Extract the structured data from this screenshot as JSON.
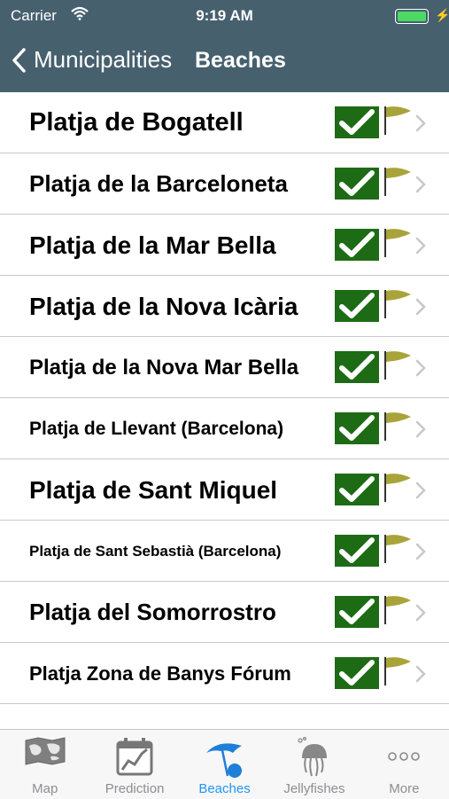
{
  "status": {
    "carrier": "Carrier",
    "time": "9:19 AM",
    "battery_level": 1.0
  },
  "nav": {
    "back_label": "Municipalities",
    "title": "Beaches"
  },
  "beaches": [
    {
      "name": "Platja de Bogatell",
      "size": "29px"
    },
    {
      "name": "Platja de la Barceloneta",
      "size": "26px"
    },
    {
      "name": "Platja de la Mar Bella",
      "size": "28px"
    },
    {
      "name": "Platja de la Nova Icària",
      "size": "28px"
    },
    {
      "name": "Platja de la Nova Mar Bella",
      "size": "24px"
    },
    {
      "name": "Platja de Llevant (Barcelona)",
      "size": "21px"
    },
    {
      "name": "Platja de Sant Miquel",
      "size": "28px"
    },
    {
      "name": "Platja de Sant Sebastià (Barcelona)",
      "size": "17px"
    },
    {
      "name": "Platja del Somorrostro",
      "size": "26px"
    },
    {
      "name": "Platja Zona de Banys Fórum",
      "size": "22px"
    }
  ],
  "tabs": [
    {
      "label": "Map",
      "icon": "map-icon",
      "active": false
    },
    {
      "label": "Prediction",
      "icon": "prediction-chart-icon",
      "active": false
    },
    {
      "label": "Beaches",
      "icon": "beach-umbrella-icon",
      "active": true
    },
    {
      "label": "Jellyfishes",
      "icon": "jellyfish-icon",
      "active": false
    },
    {
      "label": "More",
      "icon": "more-icon",
      "active": false
    }
  ],
  "colors": {
    "header": "#46606e",
    "check_bg": "#1e6b16",
    "flag": "#a9a43a",
    "active_tab": "#2196f3",
    "inactive_tab": "#8e8e93"
  }
}
